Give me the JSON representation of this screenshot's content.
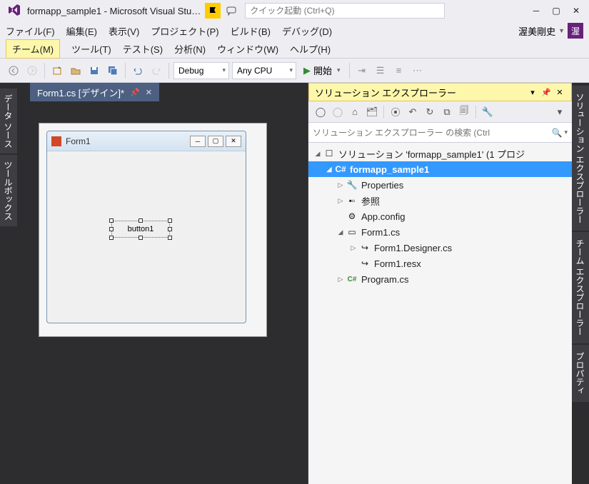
{
  "titlebar": {
    "title": "formapp_sample1 - Microsoft Visual Stu…",
    "quicklaunch_placeholder": "クイック起動 (Ctrl+Q)"
  },
  "menus": {
    "file": "ファイル(F)",
    "edit": "編集(E)",
    "view": "表示(V)",
    "project": "プロジェクト(P)",
    "build": "ビルド(B)",
    "debug": "デバッグ(D)",
    "team": "チーム(M)",
    "tools": "ツール(T)",
    "test": "テスト(S)",
    "analyze": "分析(N)",
    "window": "ウィンドウ(W)",
    "help": "ヘルプ(H)"
  },
  "user": {
    "name": "渥美剛史",
    "avatar_initial": "渥"
  },
  "toolbar": {
    "config": "Debug",
    "platform": "Any CPU",
    "start": "開始"
  },
  "doc_tab": {
    "label": "Form1.cs [デザイン]*"
  },
  "form": {
    "title": "Form1",
    "button_text": "button1"
  },
  "solution_explorer": {
    "title": "ソリューション エクスプローラー",
    "search_placeholder": "ソリューション エクスプローラー の検索 (Ctrl",
    "solution": "ソリューション 'formapp_sample1' (1 プロジ",
    "project": "formapp_sample1",
    "properties": "Properties",
    "references": "参照",
    "appconfig": "App.config",
    "form1": "Form1.cs",
    "form1designer": "Form1.Designer.cs",
    "form1resx": "Form1.resx",
    "program": "Program.cs"
  },
  "left_tabs": {
    "datasources": "データ ソース",
    "toolbox": "ツールボックス"
  },
  "right_tabs": {
    "solexp": "ソリューション エクスプローラー",
    "teamexp": "チーム エクスプローラー",
    "properties": "プロパティ"
  }
}
